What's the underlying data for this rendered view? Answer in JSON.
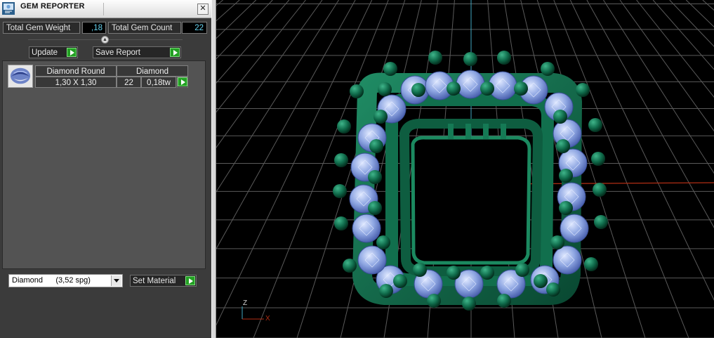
{
  "window": {
    "title": "GEM REPORTER",
    "close_glyph": "✕"
  },
  "summary": {
    "total_weight_label": "Total Gem Weight",
    "total_weight_value": ",18",
    "total_count_label": "Total Gem Count",
    "total_count_value": "22"
  },
  "actions": {
    "update_label": "Update",
    "save_label": "Save Report"
  },
  "gem_table": {
    "headers": [
      "Diamond Round",
      "Diamond"
    ],
    "rows": [
      {
        "size": "1,30 X 1,30",
        "count": "22",
        "weight": "0,18tw"
      }
    ]
  },
  "material": {
    "selected": "Diamond      (3,52 spg)",
    "set_label": "Set Material"
  },
  "viewport": {
    "axis_labels": {
      "z": "Z",
      "x": "X"
    },
    "colors": {
      "metal": "#0d5a3f",
      "gem": "#8ea6e2",
      "grid": "#5a5a5a",
      "x_axis": "#b22e14",
      "y_axis": "#3fa7c2"
    }
  }
}
